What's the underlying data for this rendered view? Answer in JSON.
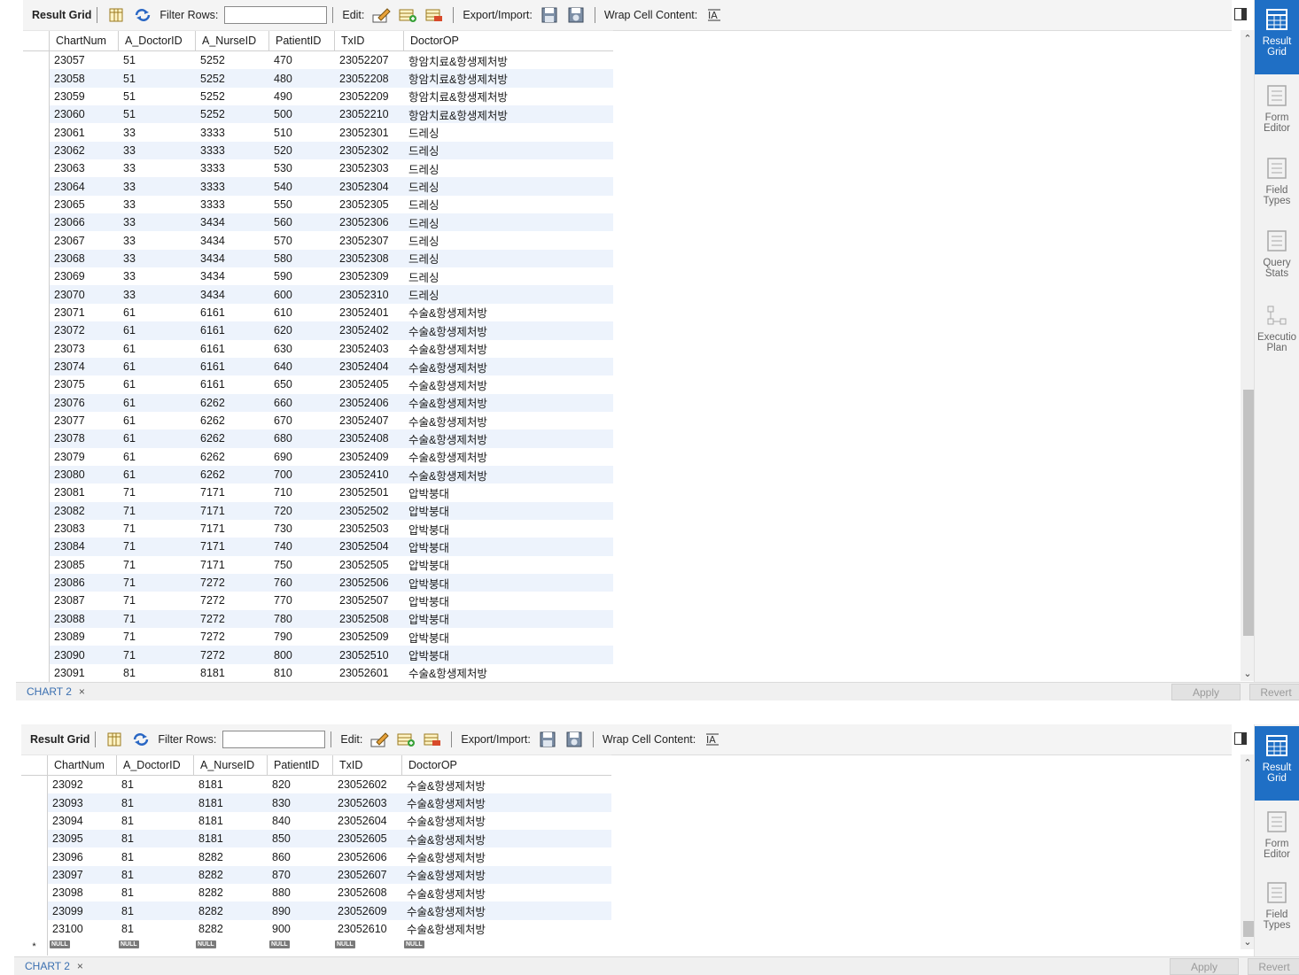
{
  "toolbar": {
    "title": "Result Grid",
    "filter_label": "Filter Rows:",
    "filter_value": "",
    "edit_label": "Edit:",
    "export_label": "Export/Import:",
    "wrap_label": "Wrap Cell Content:"
  },
  "columns": [
    "ChartNum",
    "A_DoctorID",
    "A_NurseID",
    "PatientID",
    "TxID",
    "DoctorOP"
  ],
  "grid1_rows": [
    [
      "23057",
      "51",
      "5252",
      "470",
      "23052207",
      "항암치료&항생제처방"
    ],
    [
      "23058",
      "51",
      "5252",
      "480",
      "23052208",
      "항암치료&항생제처방"
    ],
    [
      "23059",
      "51",
      "5252",
      "490",
      "23052209",
      "항암치료&항생제처방"
    ],
    [
      "23060",
      "51",
      "5252",
      "500",
      "23052210",
      "항암치료&항생제처방"
    ],
    [
      "23061",
      "33",
      "3333",
      "510",
      "23052301",
      "드레싱"
    ],
    [
      "23062",
      "33",
      "3333",
      "520",
      "23052302",
      "드레싱"
    ],
    [
      "23063",
      "33",
      "3333",
      "530",
      "23052303",
      "드레싱"
    ],
    [
      "23064",
      "33",
      "3333",
      "540",
      "23052304",
      "드레싱"
    ],
    [
      "23065",
      "33",
      "3333",
      "550",
      "23052305",
      "드레싱"
    ],
    [
      "23066",
      "33",
      "3434",
      "560",
      "23052306",
      "드레싱"
    ],
    [
      "23067",
      "33",
      "3434",
      "570",
      "23052307",
      "드레싱"
    ],
    [
      "23068",
      "33",
      "3434",
      "580",
      "23052308",
      "드레싱"
    ],
    [
      "23069",
      "33",
      "3434",
      "590",
      "23052309",
      "드레싱"
    ],
    [
      "23070",
      "33",
      "3434",
      "600",
      "23052310",
      "드레싱"
    ],
    [
      "23071",
      "61",
      "6161",
      "610",
      "23052401",
      "수술&항생제처방"
    ],
    [
      "23072",
      "61",
      "6161",
      "620",
      "23052402",
      "수술&항생제처방"
    ],
    [
      "23073",
      "61",
      "6161",
      "630",
      "23052403",
      "수술&항생제처방"
    ],
    [
      "23074",
      "61",
      "6161",
      "640",
      "23052404",
      "수술&항생제처방"
    ],
    [
      "23075",
      "61",
      "6161",
      "650",
      "23052405",
      "수술&항생제처방"
    ],
    [
      "23076",
      "61",
      "6262",
      "660",
      "23052406",
      "수술&항생제처방"
    ],
    [
      "23077",
      "61",
      "6262",
      "670",
      "23052407",
      "수술&항생제처방"
    ],
    [
      "23078",
      "61",
      "6262",
      "680",
      "23052408",
      "수술&항생제처방"
    ],
    [
      "23079",
      "61",
      "6262",
      "690",
      "23052409",
      "수술&항생제처방"
    ],
    [
      "23080",
      "61",
      "6262",
      "700",
      "23052410",
      "수술&항생제처방"
    ],
    [
      "23081",
      "71",
      "7171",
      "710",
      "23052501",
      "압박붕대"
    ],
    [
      "23082",
      "71",
      "7171",
      "720",
      "23052502",
      "압박붕대"
    ],
    [
      "23083",
      "71",
      "7171",
      "730",
      "23052503",
      "압박붕대"
    ],
    [
      "23084",
      "71",
      "7171",
      "740",
      "23052504",
      "압박붕대"
    ],
    [
      "23085",
      "71",
      "7171",
      "750",
      "23052505",
      "압박붕대"
    ],
    [
      "23086",
      "71",
      "7272",
      "760",
      "23052506",
      "압박붕대"
    ],
    [
      "23087",
      "71",
      "7272",
      "770",
      "23052507",
      "압박붕대"
    ],
    [
      "23088",
      "71",
      "7272",
      "780",
      "23052508",
      "압박붕대"
    ],
    [
      "23089",
      "71",
      "7272",
      "790",
      "23052509",
      "압박붕대"
    ],
    [
      "23090",
      "71",
      "7272",
      "800",
      "23052510",
      "압박붕대"
    ],
    [
      "23091",
      "81",
      "8181",
      "810",
      "23052601",
      "수술&항생제처방"
    ]
  ],
  "grid2_rows": [
    [
      "23092",
      "81",
      "8181",
      "820",
      "23052602",
      "수술&항생제처방"
    ],
    [
      "23093",
      "81",
      "8181",
      "830",
      "23052603",
      "수술&항생제처방"
    ],
    [
      "23094",
      "81",
      "8181",
      "840",
      "23052604",
      "수술&항생제처방"
    ],
    [
      "23095",
      "81",
      "8181",
      "850",
      "23052605",
      "수술&항생제처방"
    ],
    [
      "23096",
      "81",
      "8282",
      "860",
      "23052606",
      "수술&항생제처방"
    ],
    [
      "23097",
      "81",
      "8282",
      "870",
      "23052607",
      "수술&항생제처방"
    ],
    [
      "23098",
      "81",
      "8282",
      "880",
      "23052608",
      "수술&항생제처방"
    ],
    [
      "23099",
      "81",
      "8282",
      "890",
      "23052609",
      "수술&항생제처방"
    ],
    [
      "23100",
      "81",
      "8282",
      "900",
      "23052610",
      "수술&항생제처방"
    ]
  ],
  "null_label": "NULL",
  "new_row_marker": "*",
  "sidebar": [
    {
      "label1": "Result",
      "label2": "Grid",
      "icon": "result-grid-icon",
      "active": true
    },
    {
      "label1": "Form",
      "label2": "Editor",
      "icon": "form-editor-icon",
      "active": false
    },
    {
      "label1": "Field",
      "label2": "Types",
      "icon": "field-types-icon",
      "active": false
    },
    {
      "label1": "Query",
      "label2": "Stats",
      "icon": "query-stats-icon",
      "active": false
    },
    {
      "label1": "Executio",
      "label2": "Plan",
      "icon": "execution-plan-icon",
      "active": false
    }
  ],
  "bottom": {
    "tab_label": "CHART 2",
    "close_glyph": "×",
    "apply_label": "Apply",
    "revert_label": "Revert"
  },
  "colors": {
    "accent": "#1f6fc5",
    "alt_row": "#edf3fc",
    "tab_text": "#3a6fb0"
  }
}
